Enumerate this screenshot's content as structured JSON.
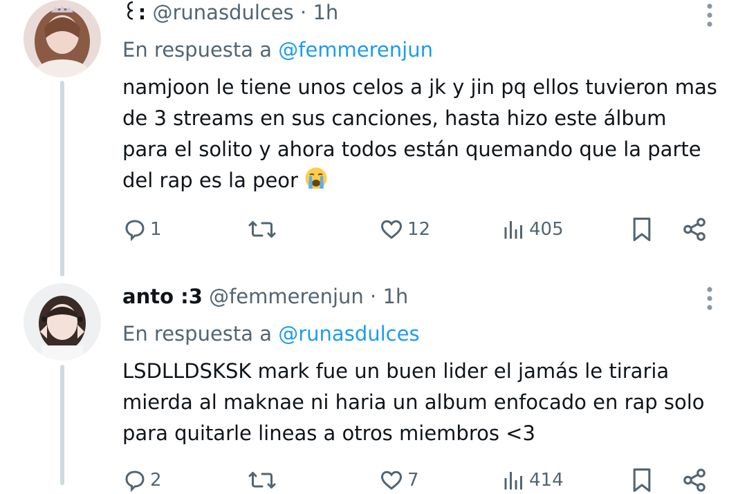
{
  "tweets": [
    {
      "display_name": "꒰:",
      "handle": "@runasdulces",
      "separator": "·",
      "time": "1h",
      "reply_prefix": "En respuesta a",
      "reply_to": "@femmerenjun",
      "body_lines": [
        "namjoon le tiene unos celos a jk y jin pq ellos tuvieron mas",
        "de 3 streams en sus canciones, hasta hizo este álbum",
        "para el solito y ahora todos están quemando que la parte",
        "del rap es la peor"
      ],
      "trailing_emoji": "loudly-crying-face",
      "replies": "1",
      "retweets": "",
      "likes": "12",
      "views": "405"
    },
    {
      "display_name": "anto :3",
      "handle": "@femmerenjun",
      "separator": "·",
      "time": "1h",
      "reply_prefix": "En respuesta a",
      "reply_to": "@runasdulces",
      "body_lines": [
        "LSDLLDSKSK mark fue un buen lider el jamás le tiraria",
        "mierda al maknae ni haria un album enfocado en rap solo",
        "para quitarle lineas a otros miembros <3"
      ],
      "replies": "2",
      "retweets": "",
      "likes": "7",
      "views": "414"
    }
  ],
  "icons": {
    "reply": "reply-icon",
    "retweet": "retweet-icon",
    "like": "heart-icon",
    "views": "views-icon",
    "bookmark": "bookmark-icon",
    "share": "share-icon",
    "more": "more-icon"
  },
  "colors": {
    "text": "#0f1419",
    "secondary": "#536471",
    "link": "#1d9bf0",
    "thread_line": "#cfd9de"
  }
}
